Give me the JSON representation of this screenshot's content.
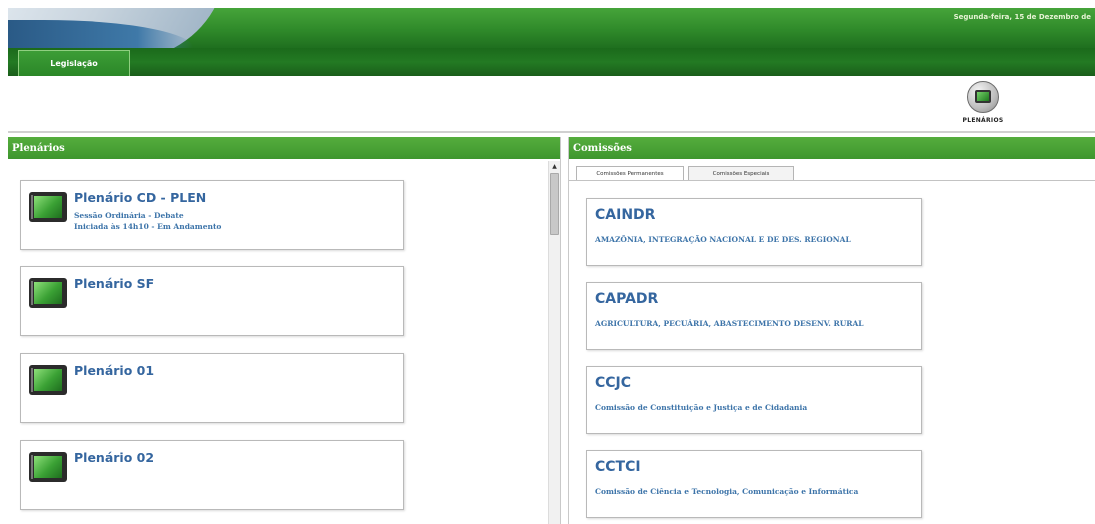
{
  "header": {
    "date_text": "Segunda-feira, 15 de Dezembro de",
    "nav_tab": "Legislação"
  },
  "toolbar": {
    "plenarios_logo_caption": "PLENÁRIOS"
  },
  "left_panel": {
    "title": "Plenários",
    "cards": [
      {
        "title": "Plenário CD - PLEN",
        "line1": "Sessão Ordinária - Debate",
        "line2": "Iniciada às 14h10 - Em Andamento"
      },
      {
        "title": "Plenário SF",
        "line1": "",
        "line2": ""
      },
      {
        "title": "Plenário 01",
        "line1": "",
        "line2": ""
      },
      {
        "title": "Plenário 02",
        "line1": "",
        "line2": ""
      }
    ]
  },
  "right_panel": {
    "title": "Comissões",
    "tabs": [
      "Comissões Permanentes",
      "Comissões Especiais"
    ],
    "cards": [
      {
        "code": "CAINDR",
        "name": "AMAZÔNIA, INTEGRAÇÃO NACIONAL E DE DES. REGIONAL"
      },
      {
        "code": "CAPADR",
        "name": "AGRICULTURA, PECUÁRIA, ABASTECIMENTO DESENV. RURAL"
      },
      {
        "code": "CCJC",
        "name": "Comissão de Constituição e Justiça e de Cidadania"
      },
      {
        "code": "CCTCI",
        "name": "Comissão de Ciência e Tecnologia, Comunicação e Informática"
      }
    ]
  },
  "colors": {
    "header_green": "#3e962e",
    "nav_green": "#1f6f1f",
    "link_blue": "#35669f"
  }
}
